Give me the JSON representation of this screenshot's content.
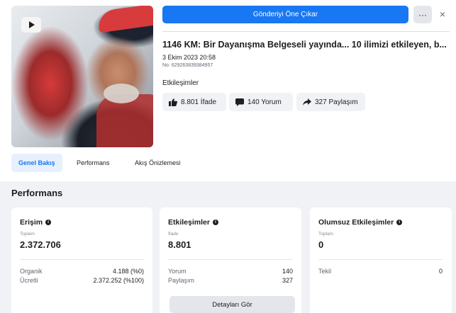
{
  "toolbar": {
    "boost_label": "Gönderiyi Öne Çıkar",
    "more_label": "···",
    "close_label": "×"
  },
  "post": {
    "title": "1146 KM: Bir Dayanışma Belgeseli yayında... 10 ilimizi etkileyen, b...",
    "date": "3 Ekim 2023 20:58",
    "id_label": "No: 629263839384957",
    "engagements_label": "Etkileşimler",
    "likes": "8.801 İfade",
    "comments": "140 Yorum",
    "shares": "327 Paylaşım"
  },
  "tabs": [
    {
      "label": "Genel Bakış",
      "active": true
    },
    {
      "label": "Performans",
      "active": false
    },
    {
      "label": "Akış Önizlemesi",
      "active": false
    }
  ],
  "performance": {
    "section_title": "Performans",
    "reach": {
      "title": "Erişim",
      "sub_label": "Toplam",
      "total": "2.372.706",
      "rows": [
        {
          "label": "Organik",
          "value": "4.188 (%0)"
        },
        {
          "label": "Ücretli",
          "value": "2.372.252 (%100)"
        }
      ]
    },
    "engagements": {
      "title": "Etkileşimler",
      "sub_label": "İfade",
      "total": "8.801",
      "rows": [
        {
          "label": "Yorum",
          "value": "140"
        },
        {
          "label": "Paylaşım",
          "value": "327"
        }
      ],
      "details_label": "Detayları Gör"
    },
    "negative": {
      "title": "Olumsuz Etkileşimler",
      "sub_label": "Toplam",
      "total": "0",
      "rows": [
        {
          "label": "Tekil",
          "value": "0"
        }
      ]
    }
  },
  "colors": {
    "accent": "#1877f2",
    "background": "#f0f2f5",
    "card": "#ffffff"
  },
  "icons": {
    "thumbnail_badge": "play-icon",
    "likes": "thumbs-up-icon",
    "comments": "comment-icon",
    "shares": "share-arrow-icon",
    "info": "info-icon"
  }
}
